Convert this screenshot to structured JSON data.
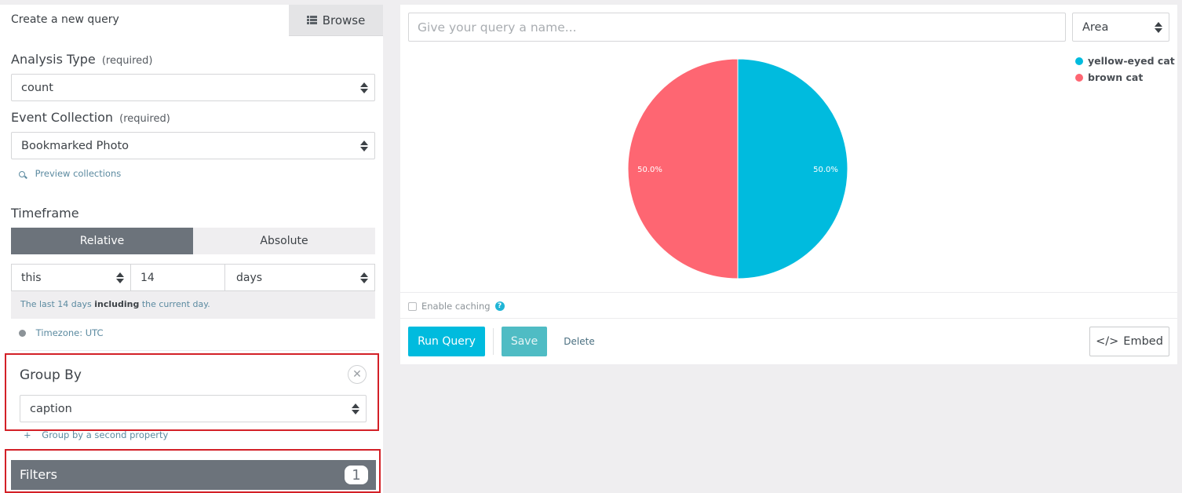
{
  "tabs": {
    "create_label": "Create a new query",
    "browse_label": "Browse"
  },
  "analysis_type": {
    "label": "Analysis Type",
    "required": "(required)",
    "value": "count"
  },
  "event_collection": {
    "label": "Event Collection",
    "required": "(required)",
    "value": "Bookmarked Photo",
    "preview_link": "Preview collections"
  },
  "timeframe": {
    "label": "Timeframe",
    "relative_label": "Relative",
    "absolute_label": "Absolute",
    "selected": "Relative",
    "relativity": "this",
    "amount": "14",
    "units": "days",
    "note_pre": "The last 14 days ",
    "note_bold": "including",
    "note_post": " the current day.",
    "timezone": "Timezone: UTC"
  },
  "group_by": {
    "title": "Group By",
    "close_glyph": "✕",
    "value": "caption",
    "add_second": "Group by a second property",
    "add_glyph": "+"
  },
  "filters": {
    "label": "Filters",
    "count": "1"
  },
  "query": {
    "name_placeholder": "Give your query a name...",
    "chart_type": "Area"
  },
  "legend": [
    {
      "label": "yellow-eyed cat",
      "color": "#00bbde"
    },
    {
      "label": "brown cat",
      "color": "#fe6672"
    }
  ],
  "chart_data": {
    "type": "pie",
    "categories": [
      "yellow-eyed cat",
      "brown cat"
    ],
    "values": [
      50.0,
      50.0
    ],
    "data_labels": [
      "50.0%",
      "50.0%"
    ],
    "colors": [
      "#00bbde",
      "#fe6672"
    ],
    "legend_position": "top-right"
  },
  "caching": {
    "label": "Enable caching",
    "checked": false,
    "help_glyph": "?"
  },
  "actions": {
    "run_label": "Run Query",
    "save_label": "Save",
    "delete_label": "Delete",
    "embed_glyph": "</>",
    "embed_label": "Embed"
  }
}
